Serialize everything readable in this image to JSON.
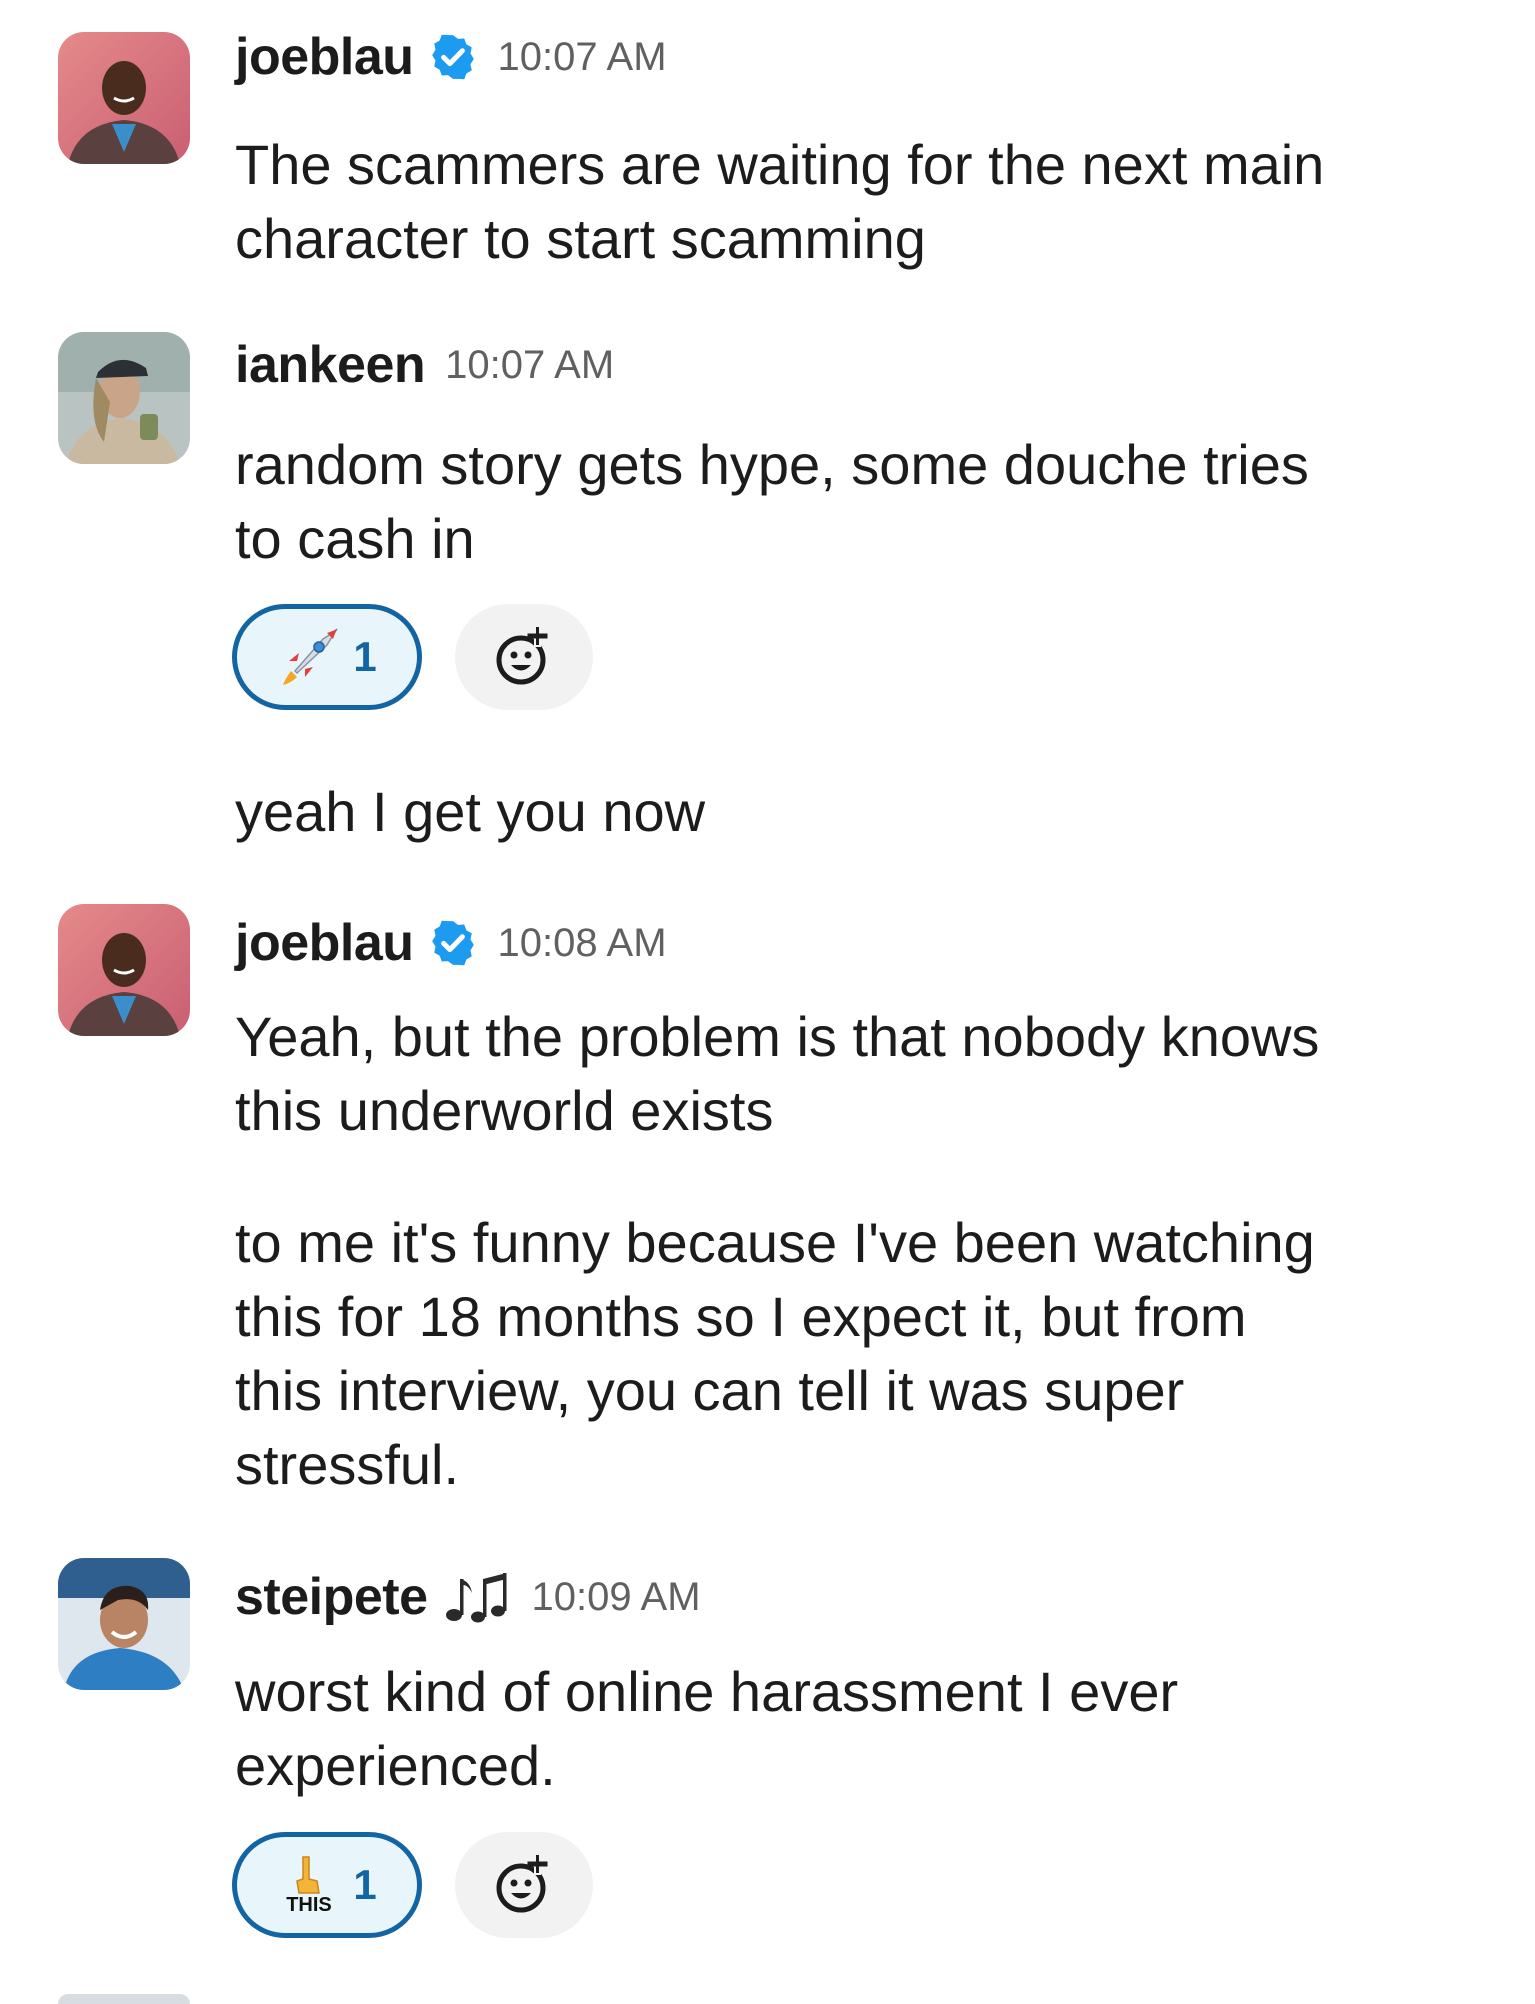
{
  "colors": {
    "text": "#1d1c1d",
    "timestamp": "#616061",
    "reaction_border": "#1264a3",
    "reaction_bg": "#e8f5fa",
    "verified": "#1d9bf0"
  },
  "messages": [
    {
      "author": "joeblau",
      "verified": true,
      "time": "10:07 AM",
      "lines": [
        "The scammers are waiting for the next main",
        "character to start scamming"
      ]
    },
    {
      "author": "iankeen",
      "verified": false,
      "time": "10:07 AM",
      "lines": [
        "random story gets hype, some douche tries",
        "to cash in"
      ],
      "reaction": {
        "emoji": "rocket-emoji",
        "count": "1"
      },
      "followup": "yeah I get you now"
    },
    {
      "author": "joeblau",
      "verified": true,
      "time": "10:08 AM",
      "lines": [
        "Yeah, but the problem is that nobody knows",
        "this underworld exists"
      ],
      "paragraph2": [
        "to me it's funny because I've been watching",
        "this for 18 months so I expect it, but from",
        "this interview, you can tell it was super",
        "stressful."
      ]
    },
    {
      "author": "steipete",
      "status_icon": "music-notes-icon",
      "time": "10:09 AM",
      "lines": [
        "worst kind of online harassment I ever",
        "experienced."
      ],
      "reaction": {
        "emoji": "this-emoji",
        "emoji_text": "THIS",
        "count": "1"
      }
    }
  ]
}
